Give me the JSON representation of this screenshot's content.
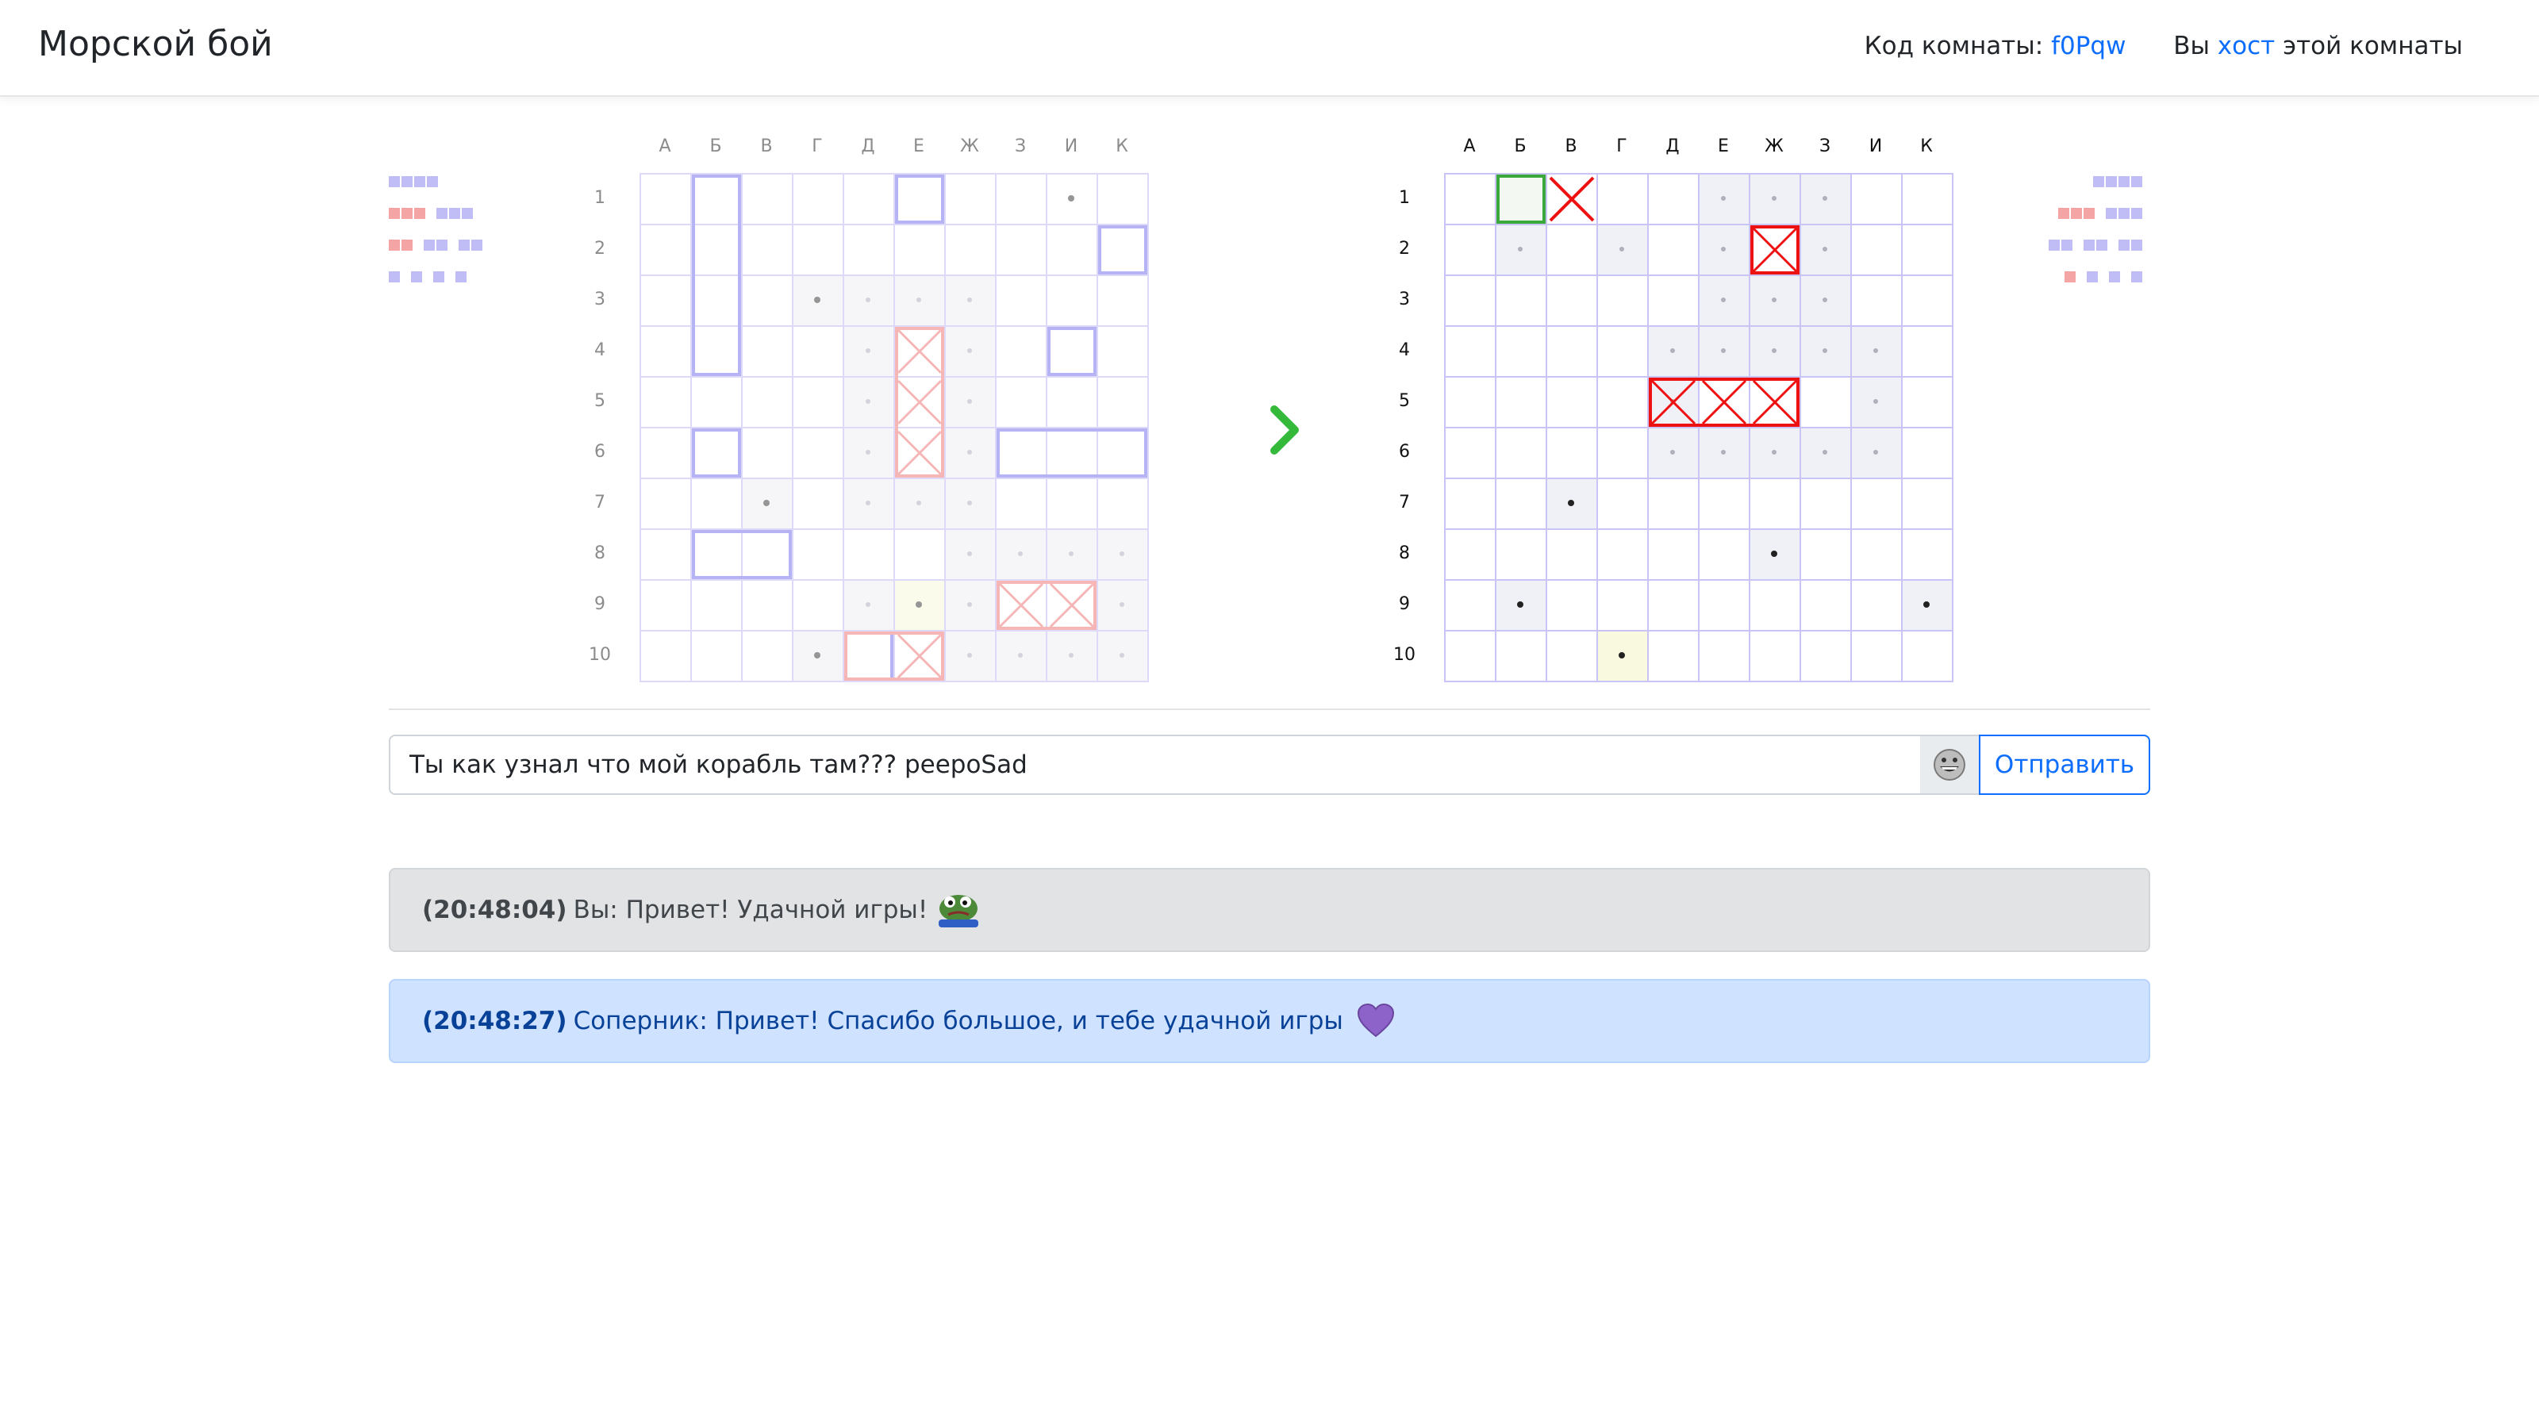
{
  "app": {
    "title": "Морской бой",
    "room_code_label": "Код комнаты:",
    "room_code": "f0Pqw",
    "host_prefix": "Вы",
    "host_word": "хост",
    "host_suffix": "этой комнаты"
  },
  "columns": [
    "А",
    "Б",
    "В",
    "Г",
    "Д",
    "Е",
    "Ж",
    "З",
    "И",
    "К"
  ],
  "rows": [
    "1",
    "2",
    "3",
    "4",
    "5",
    "6",
    "7",
    "8",
    "9",
    "10"
  ],
  "own_board": {
    "ships": [
      {
        "col": 1,
        "row": 0,
        "w": 1,
        "h": 4
      },
      {
        "col": 5,
        "row": 0,
        "w": 1,
        "h": 1
      },
      {
        "col": 9,
        "row": 1,
        "w": 1,
        "h": 1
      },
      {
        "col": 8,
        "row": 3,
        "w": 1,
        "h": 1
      },
      {
        "col": 1,
        "row": 5,
        "w": 1,
        "h": 1
      },
      {
        "col": 7,
        "row": 5,
        "w": 3,
        "h": 1
      },
      {
        "col": 1,
        "row": 7,
        "w": 2,
        "h": 1
      },
      {
        "col": 4,
        "row": 9,
        "w": 1,
        "h": 1
      }
    ],
    "hits": [
      [
        5,
        3
      ],
      [
        5,
        4
      ],
      [
        5,
        5
      ],
      [
        7,
        8
      ],
      [
        8,
        8
      ],
      [
        5,
        9
      ]
    ],
    "sunk": [
      {
        "col": 5,
        "row": 3,
        "w": 1,
        "h": 3
      },
      {
        "col": 7,
        "row": 8,
        "w": 2,
        "h": 1
      },
      {
        "col": 4,
        "row": 9,
        "w": 2,
        "h": 1
      }
    ],
    "misses": [
      [
        8,
        0
      ],
      [
        3,
        2
      ],
      [
        2,
        6
      ],
      [
        5,
        8
      ],
      [
        3,
        9
      ]
    ],
    "shaded": [
      [
        3,
        2
      ],
      [
        4,
        2
      ],
      [
        5,
        2
      ],
      [
        6,
        2
      ],
      [
        4,
        3
      ],
      [
        6,
        3
      ],
      [
        4,
        4
      ],
      [
        6,
        4
      ],
      [
        4,
        5
      ],
      [
        6,
        5
      ],
      [
        2,
        6
      ],
      [
        4,
        6
      ],
      [
        5,
        6
      ],
      [
        6,
        6
      ],
      [
        6,
        7
      ],
      [
        7,
        7
      ],
      [
        8,
        7
      ],
      [
        9,
        7
      ],
      [
        4,
        8
      ],
      [
        5,
        8
      ],
      [
        6,
        8
      ],
      [
        9,
        8
      ],
      [
        6,
        9
      ],
      [
        7,
        9
      ],
      [
        8,
        9
      ],
      [
        9,
        9
      ],
      [
        3,
        9
      ]
    ],
    "faint_dots": [
      [
        4,
        2
      ],
      [
        5,
        2
      ],
      [
        6,
        2
      ],
      [
        4,
        3
      ],
      [
        6,
        3
      ],
      [
        4,
        4
      ],
      [
        6,
        4
      ],
      [
        4,
        5
      ],
      [
        6,
        5
      ],
      [
        4,
        6
      ],
      [
        5,
        6
      ],
      [
        6,
        6
      ],
      [
        6,
        7
      ],
      [
        7,
        7
      ],
      [
        8,
        7
      ],
      [
        9,
        7
      ],
      [
        4,
        8
      ],
      [
        6,
        8
      ],
      [
        9,
        8
      ],
      [
        6,
        9
      ],
      [
        7,
        9
      ],
      [
        8,
        9
      ],
      [
        9,
        9
      ]
    ],
    "highlight": [
      [
        5,
        8
      ]
    ]
  },
  "enemy_board": {
    "selected": [
      [
        1,
        0
      ]
    ],
    "cross_miss": [
      [
        2,
        0
      ]
    ],
    "hits": [
      [
        6,
        1
      ],
      [
        4,
        4
      ],
      [
        5,
        4
      ],
      [
        6,
        4
      ]
    ],
    "sunk": [
      {
        "col": 6,
        "row": 1,
        "w": 1,
        "h": 1
      },
      {
        "col": 4,
        "row": 4,
        "w": 3,
        "h": 1
      }
    ],
    "shaded": [
      [
        5,
        0
      ],
      [
        6,
        0
      ],
      [
        7,
        0
      ],
      [
        1,
        1
      ],
      [
        3,
        1
      ],
      [
        5,
        1
      ],
      [
        7,
        1
      ],
      [
        5,
        2
      ],
      [
        6,
        2
      ],
      [
        7,
        2
      ],
      [
        4,
        3
      ],
      [
        5,
        3
      ],
      [
        6,
        3
      ],
      [
        7,
        3
      ],
      [
        8,
        3
      ],
      [
        4,
        4
      ],
      [
        8,
        4
      ],
      [
        4,
        5
      ],
      [
        5,
        5
      ],
      [
        6,
        5
      ],
      [
        7,
        5
      ],
      [
        8,
        5
      ],
      [
        2,
        6
      ],
      [
        6,
        7
      ],
      [
        1,
        8
      ],
      [
        9,
        8
      ],
      [
        3,
        9
      ]
    ],
    "faint_dots": [
      [
        5,
        0
      ],
      [
        6,
        0
      ],
      [
        7,
        0
      ],
      [
        1,
        1
      ],
      [
        3,
        1
      ],
      [
        5,
        1
      ],
      [
        7,
        1
      ],
      [
        5,
        2
      ],
      [
        6,
        2
      ],
      [
        7,
        2
      ],
      [
        4,
        3
      ],
      [
        5,
        3
      ],
      [
        6,
        3
      ],
      [
        7,
        3
      ],
      [
        8,
        3
      ],
      [
        4,
        4
      ],
      [
        8,
        4
      ],
      [
        4,
        5
      ],
      [
        5,
        5
      ],
      [
        6,
        5
      ],
      [
        7,
        5
      ],
      [
        8,
        5
      ]
    ],
    "misses": [
      [
        2,
        6
      ],
      [
        6,
        7
      ],
      [
        1,
        8
      ],
      [
        9,
        8
      ],
      [
        3,
        9
      ]
    ],
    "highlight": [
      [
        3,
        9
      ]
    ]
  },
  "fleet_left": [
    [
      {
        "len": 4,
        "state": "alive"
      }
    ],
    [
      {
        "len": 3,
        "state": "sunk"
      },
      {
        "len": 3,
        "state": "alive"
      }
    ],
    [
      {
        "len": 2,
        "state": "sunk"
      },
      {
        "len": 2,
        "state": "alive"
      },
      {
        "len": 2,
        "state": "alive"
      }
    ],
    [
      {
        "len": 1,
        "state": "alive"
      },
      {
        "len": 1,
        "state": "alive"
      },
      {
        "len": 1,
        "state": "alive"
      },
      {
        "len": 1,
        "state": "alive"
      }
    ]
  ],
  "fleet_right": [
    [
      {
        "len": 4,
        "state": "alive"
      }
    ],
    [
      {
        "len": 3,
        "state": "sunk"
      },
      {
        "len": 3,
        "state": "alive"
      }
    ],
    [
      {
        "len": 2,
        "state": "alive"
      },
      {
        "len": 2,
        "state": "alive"
      },
      {
        "len": 2,
        "state": "alive"
      }
    ],
    [
      {
        "len": 1,
        "state": "sunk"
      },
      {
        "len": 1,
        "state": "alive"
      },
      {
        "len": 1,
        "state": "alive"
      },
      {
        "len": 1,
        "state": "alive"
      }
    ]
  ],
  "chat": {
    "input_value": "Ты как узнал что мой корабль там??? peepoSad",
    "send_label": "Отправить",
    "messages": [
      {
        "time": "(20:48:04)",
        "text": "Вы: Привет! Удачной игры!",
        "kind": "self",
        "emoji": "peepo-frog-icon"
      },
      {
        "time": "(20:48:27)",
        "text": "Соперник: Привет! Спасибо большое, и тебе удачной игры",
        "kind": "opponent",
        "emoji": "purple-heart-icon"
      }
    ]
  },
  "colors": {
    "grid_line": "#c8c4f5",
    "ship": "#8a85ee",
    "hit": "#f08a8a",
    "hit_strong": "#ee1111",
    "shade": "#f0f1f6",
    "highlight": "#f9f9df",
    "selected": "#3aa83a",
    "arrow": "#35b93a",
    "fleet_alive": "#c0bdf6",
    "fleet_sunk": "#f4a4a4"
  }
}
